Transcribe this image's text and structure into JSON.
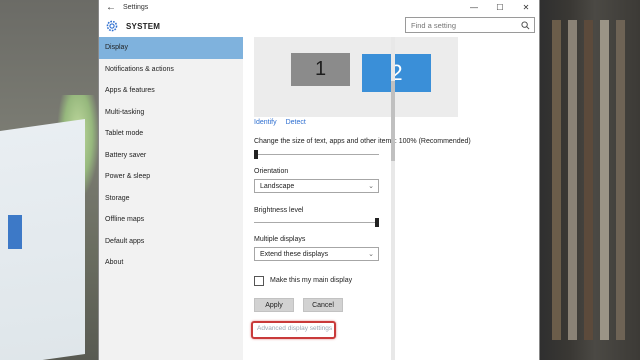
{
  "window": {
    "title": "Settings",
    "controls": {
      "minimize": "—",
      "maximize": "☐",
      "close": "✕"
    },
    "back_icon": "back-arrow-icon"
  },
  "header": {
    "section_title": "SYSTEM",
    "search_placeholder": "Find a setting"
  },
  "sidebar": {
    "items": [
      {
        "label": "Display",
        "active": true
      },
      {
        "label": "Notifications & actions"
      },
      {
        "label": "Apps & features"
      },
      {
        "label": "Multi-tasking"
      },
      {
        "label": "Tablet mode"
      },
      {
        "label": "Battery saver"
      },
      {
        "label": "Power & sleep"
      },
      {
        "label": "Storage"
      },
      {
        "label": "Offline maps"
      },
      {
        "label": "Default apps"
      },
      {
        "label": "About"
      }
    ]
  },
  "display": {
    "monitors": [
      "1",
      "2"
    ],
    "identify_label": "Identify",
    "detect_label": "Detect",
    "scale_label": "Change the size of text, apps and other items: 100% (Recommended)",
    "scale_level": 0,
    "orientation_label": "Orientation",
    "orientation_value": "Landscape",
    "brightness_label": "Brightness level",
    "brightness_level": 1.0,
    "multiple_displays_label": "Multiple displays",
    "multiple_displays_value": "Extend these displays",
    "main_display_label": "Make this my main display",
    "main_display_checked": false,
    "apply_label": "Apply",
    "cancel_label": "Cancel",
    "advanced_link": "Advanced display settings"
  },
  "colors": {
    "accent": "#3a8fd8",
    "sidebar_active": "#7fb2dd",
    "link": "#2e6fd0",
    "highlight": "#c93a3a"
  }
}
